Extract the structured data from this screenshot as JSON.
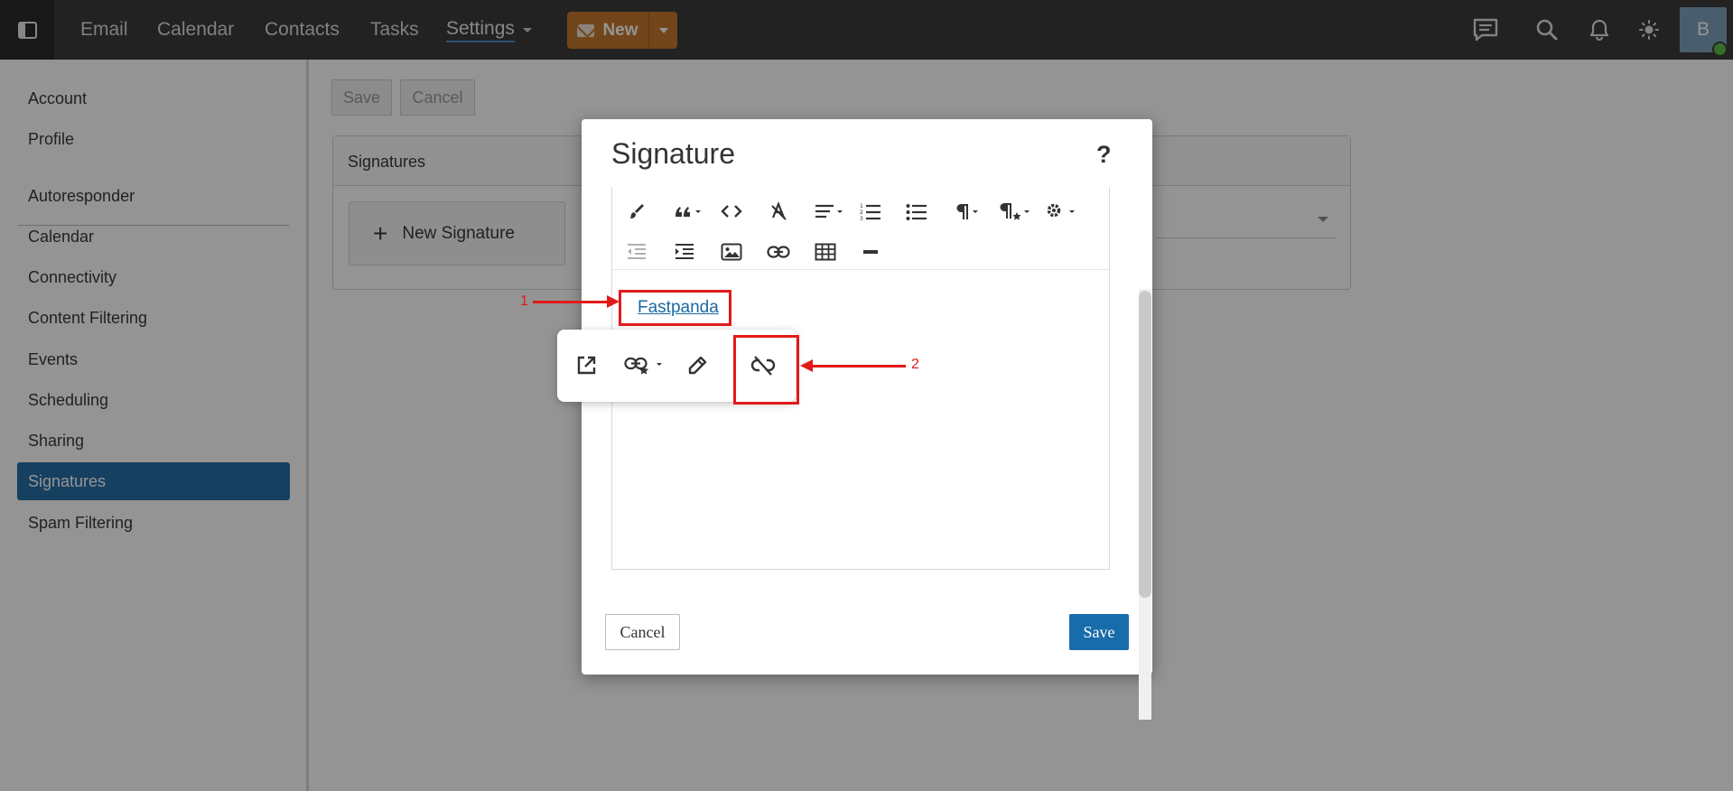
{
  "topbar": {
    "nav": [
      "Email",
      "Calendar",
      "Contacts",
      "Tasks",
      "Settings"
    ],
    "new_label": "New",
    "avatar_initial": "B",
    "background": "#3c3c3c",
    "new_button_color": "#c4782d",
    "icons": [
      "sidebar-toggle-icon",
      "chat-icon",
      "search-icon",
      "bell-icon",
      "sun-icon"
    ]
  },
  "sidebar": {
    "items": [
      "Account",
      "Profile",
      "Autoresponder",
      "Calendar",
      "Connectivity",
      "Content Filtering",
      "Events",
      "Scheduling",
      "Sharing",
      "Signatures",
      "Spam Filtering"
    ],
    "active": "Signatures",
    "active_color": "#266ea6"
  },
  "main": {
    "save_label": "Save",
    "cancel_label": "Cancel",
    "panel_title": "Signatures",
    "new_signature_label": "New Signature"
  },
  "modal": {
    "title": "Signature",
    "help": "?",
    "link_text": "Fastpanda",
    "cancel_label": "Cancel",
    "save_label": "Save",
    "save_color": "#176ca9",
    "toolbar_icons": [
      "brush-icon",
      "quote-icon",
      "code-icon",
      "clear-format-icon",
      "align-icon",
      "ordered-list-icon",
      "unordered-list-icon",
      "paragraph-icon",
      "paragraph-style-icon",
      "gear-icon",
      "outdent-icon",
      "indent-icon",
      "image-icon",
      "link-icon",
      "table-icon",
      "horizontal-rule-icon"
    ],
    "popover_icons": [
      "open-link-icon",
      "link-style-icon",
      "edit-link-icon",
      "unlink-icon"
    ]
  },
  "annotations": {
    "labels": [
      "1",
      "2"
    ],
    "color": "#e21a1a"
  }
}
